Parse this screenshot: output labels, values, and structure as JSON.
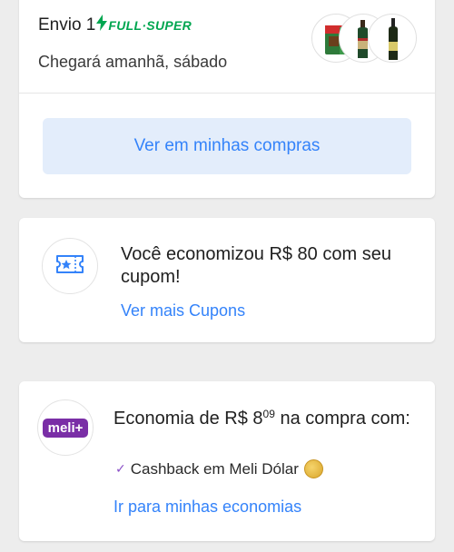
{
  "shipment": {
    "title": "Envio 1",
    "full_label": "FULL·SUPER",
    "arrival": "Chegará amanhã, sábado",
    "action_label": "Ver em minhas compras",
    "products": [
      "Melitta coffee box",
      "green bottle",
      "dark bottle"
    ]
  },
  "coupon": {
    "message": "Você economizou R$ 80 com seu cupom!",
    "link_label": "Ver mais Cupons"
  },
  "meli": {
    "logo_text": "meli+",
    "economy_prefix": "Economia de R$ 8",
    "economy_cents": "09",
    "economy_suffix": " na compra com:",
    "cashback_label": "Cashback em Meli Dólar",
    "link_label": "Ir para minhas economias"
  },
  "colors": {
    "accent": "#3483fa",
    "full_green": "#00a650",
    "meli_purple": "#7a2ea6"
  }
}
